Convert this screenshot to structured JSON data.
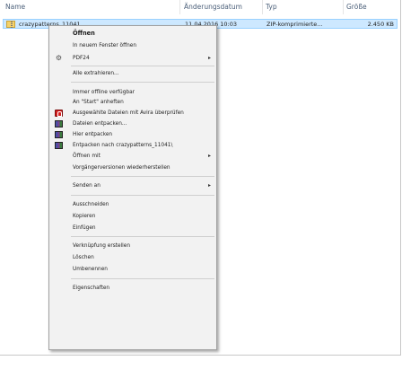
{
  "columns": {
    "name": "Name",
    "date": "Änderungsdatum",
    "type": "Typ",
    "size": "Größe"
  },
  "selected_file": {
    "name": "crazypatterns_11041",
    "date": "11.04.2016 10:03",
    "type": "ZIP-komprimierte...",
    "size": "2.450 KB"
  },
  "menu": {
    "open": "Öffnen",
    "open_new_window": "In neuem Fenster öffnen",
    "pdf24": "PDF24",
    "extract_all": "Alle extrahieren...",
    "always_offline": "Immer offline verfügbar",
    "pin_start": "An \"Start\" anheften",
    "avira_scan": "Ausgewählte Dateien mit Avira überprüfen",
    "unpack_files": "Dateien entpacken...",
    "extract_here": "Hier entpacken",
    "extract_to": "Entpacken nach crazypatterns_11041\\",
    "open_with": "Öffnen mit",
    "restore_versions": "Vorgängerversionen wiederherstellen",
    "send_to": "Senden an",
    "cut": "Ausschneiden",
    "copy": "Kopieren",
    "paste": "Einfügen",
    "create_shortcut": "Verknüpfung erstellen",
    "delete": "Löschen",
    "rename": "Umbenennen",
    "properties": "Eigenschaften"
  },
  "icons": {
    "pdf24": "gear-icon",
    "avira": "avira-umbrella-icon",
    "winrar": "winrar-books-icon",
    "zip": "zip-folder-icon"
  },
  "colors": {
    "selection_bg": "#cde8ff",
    "selection_border": "#99d1ff",
    "menu_bg": "#f2f2f2",
    "header_text": "#4c607a"
  }
}
